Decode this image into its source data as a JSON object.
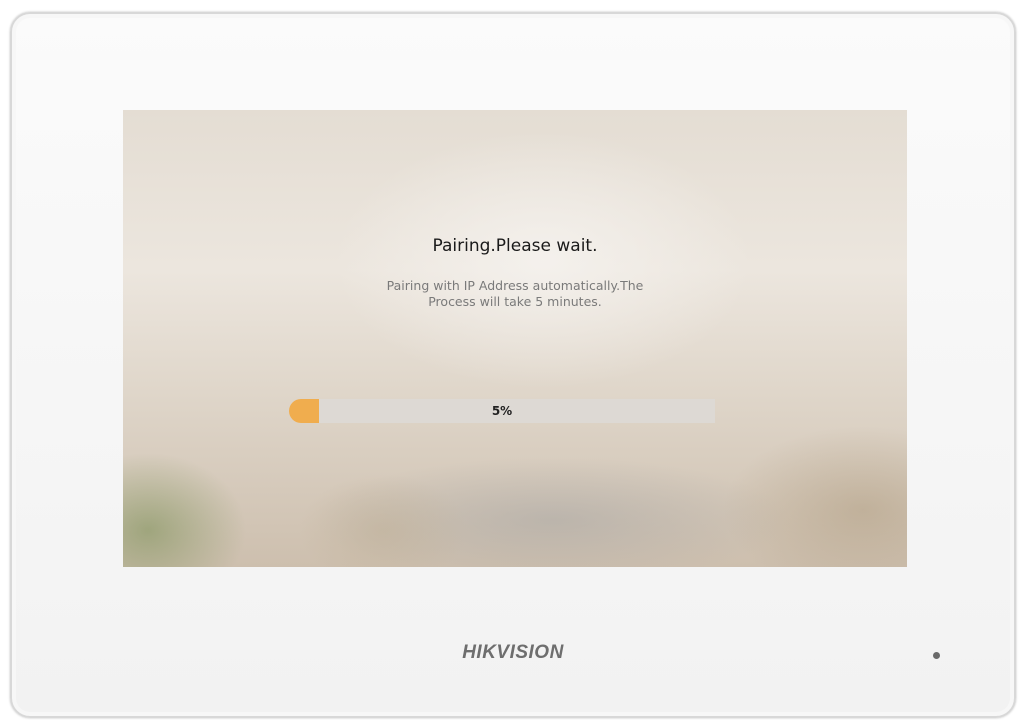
{
  "device": {
    "brand": "HIKVISION"
  },
  "screen": {
    "title": "Pairing.Please wait.",
    "message_line1": "Pairing with IP Address automatically.The",
    "message_line2": "Process will take 5 minutes.",
    "progress": {
      "percent": 5,
      "label": "5%",
      "fill_color": "#f0ad4e",
      "track_color": "#ddd9d4"
    }
  },
  "icons": {
    "indicator": "status-led-icon"
  }
}
